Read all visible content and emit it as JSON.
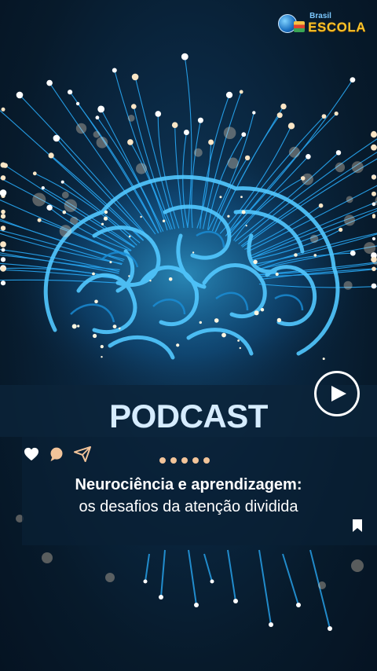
{
  "brand": {
    "line1": "Brasil",
    "line2": "ESCOLA"
  },
  "post": {
    "title": "PODCAST",
    "subtitle_bold": "Neurociência e aprendizagem:",
    "subtitle_regular": "os desafios da atenção dividida"
  },
  "icons": {
    "play": "play-icon",
    "like": "heart-icon",
    "comment": "comment-icon",
    "share": "send-icon",
    "save": "bookmark-icon",
    "logo": "globe-books-icon"
  },
  "carousel": {
    "count": 5,
    "color": "#f2c49a"
  },
  "colors": {
    "title": "#d6ecff",
    "accent_glow": "#35b8ff",
    "background": "#071a2b"
  }
}
